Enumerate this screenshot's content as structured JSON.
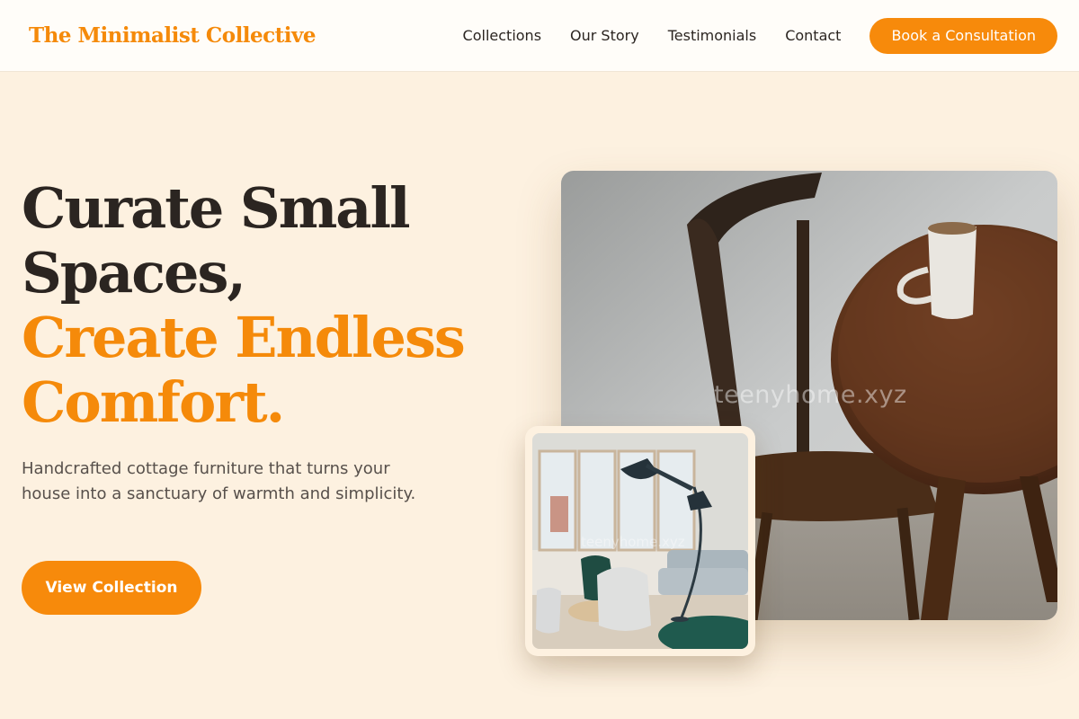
{
  "header": {
    "brand": "The Minimalist Collective",
    "nav": [
      "Collections",
      "Our Story",
      "Testimonials",
      "Contact"
    ],
    "cta_label": "Book a Consultation"
  },
  "hero": {
    "title_line1": "Curate Small",
    "title_line2": "Spaces,",
    "title_line3": "Create Endless",
    "title_line4": "Comfort.",
    "subtitle": "Handcrafted cottage furniture that turns your house into a sanctuary of warmth and simplicity.",
    "button_label": "View Collection"
  },
  "images": {
    "main_watermark": "teenyhome.xyz",
    "inset_watermark": "teenyhome.xyz"
  },
  "colors": {
    "accent": "#f58a0a",
    "background": "#fdf1e0",
    "text_dark": "#2b2521"
  }
}
